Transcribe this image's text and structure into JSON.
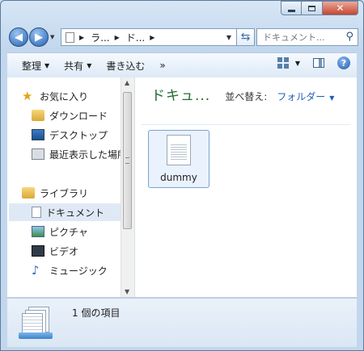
{
  "window": {
    "minimize_icon": "minimize-icon",
    "maximize_icon": "maximize-icon",
    "close_icon": "close-icon"
  },
  "address": {
    "crumbs": [
      "ラ...",
      "ド..."
    ],
    "refresh_icon": "refresh-icon"
  },
  "search": {
    "placeholder": "ドキュメント..."
  },
  "toolbar": {
    "organize": "整理",
    "share": "共有",
    "burn": "書き込む",
    "more": "»"
  },
  "nav": {
    "favorites_label": "お気に入り",
    "downloads_label": "ダウンロード",
    "desktop_label": "デスクトップ",
    "recent_label": "最近表示した場所",
    "libraries_label": "ライブラリ",
    "documents_label": "ドキュメント",
    "pictures_label": "ピクチャ",
    "videos_label": "ビデオ",
    "music_label": "ミュージック"
  },
  "content": {
    "title": "ドキュ...",
    "sort_label": "並べ替え:",
    "sort_value": "フォルダー",
    "files": [
      {
        "name": "dummy"
      }
    ]
  },
  "details": {
    "item_count": "1 個の項目"
  }
}
